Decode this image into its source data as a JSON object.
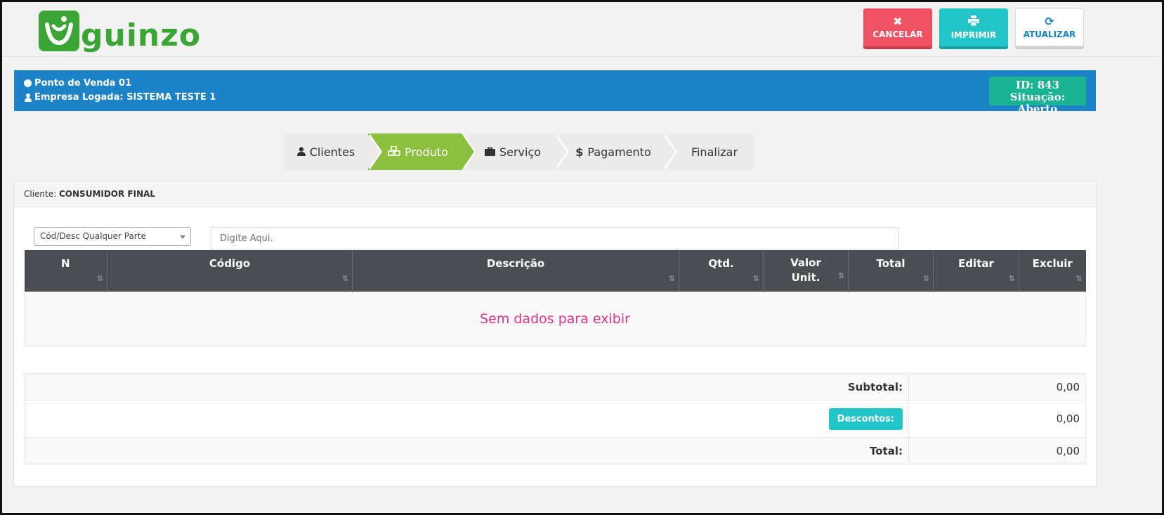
{
  "brand": {
    "logo_text": "guinzo",
    "color": "#3aa535"
  },
  "toolbar": {
    "cancel_label": "CANCELAR",
    "print_label": "IMPRIMIR",
    "refresh_label": "ATUALIZAR",
    "cancel_color": "#ef5363",
    "print_color": "#23c6c8",
    "refresh_color": "#1c84c6"
  },
  "info": {
    "pos_label": "Ponto de Venda 01",
    "company_label": "Empresa Logada: SISTEMA TESTE 1",
    "id_text": "ID: 843",
    "status_text": "Situação: Aberto",
    "bar_color": "#1c84c6",
    "badge_color": "#1ab394"
  },
  "steps": [
    {
      "label": "Clientes",
      "icon": "user-icon",
      "active": false
    },
    {
      "label": "Produto",
      "icon": "cubes-icon",
      "active": true
    },
    {
      "label": "Serviço",
      "icon": "briefcase-icon",
      "active": false
    },
    {
      "label": "Pagamento",
      "icon": "dollar-icon",
      "active": false
    },
    {
      "label": "Finalizar",
      "icon": "",
      "active": false
    }
  ],
  "client": {
    "prefix": "Cliente:",
    "name": "CONSUMIDOR FINAL"
  },
  "search": {
    "mode_selected": "Cód/Desc Qualquer Parte",
    "placeholder": "Digite Aqui."
  },
  "table": {
    "columns": [
      "N",
      "Código",
      "Descrição",
      "Qtd.",
      "Valor Unit.",
      "Total",
      "Editar",
      "Excluir"
    ],
    "empty_message": "Sem dados para exibir"
  },
  "totals": {
    "subtotal_label": "Subtotal:",
    "subtotal_value": "0,00",
    "discount_label": "Descontos:",
    "discount_value": "0,00",
    "total_label": "Total:",
    "total_value": "0,00"
  }
}
